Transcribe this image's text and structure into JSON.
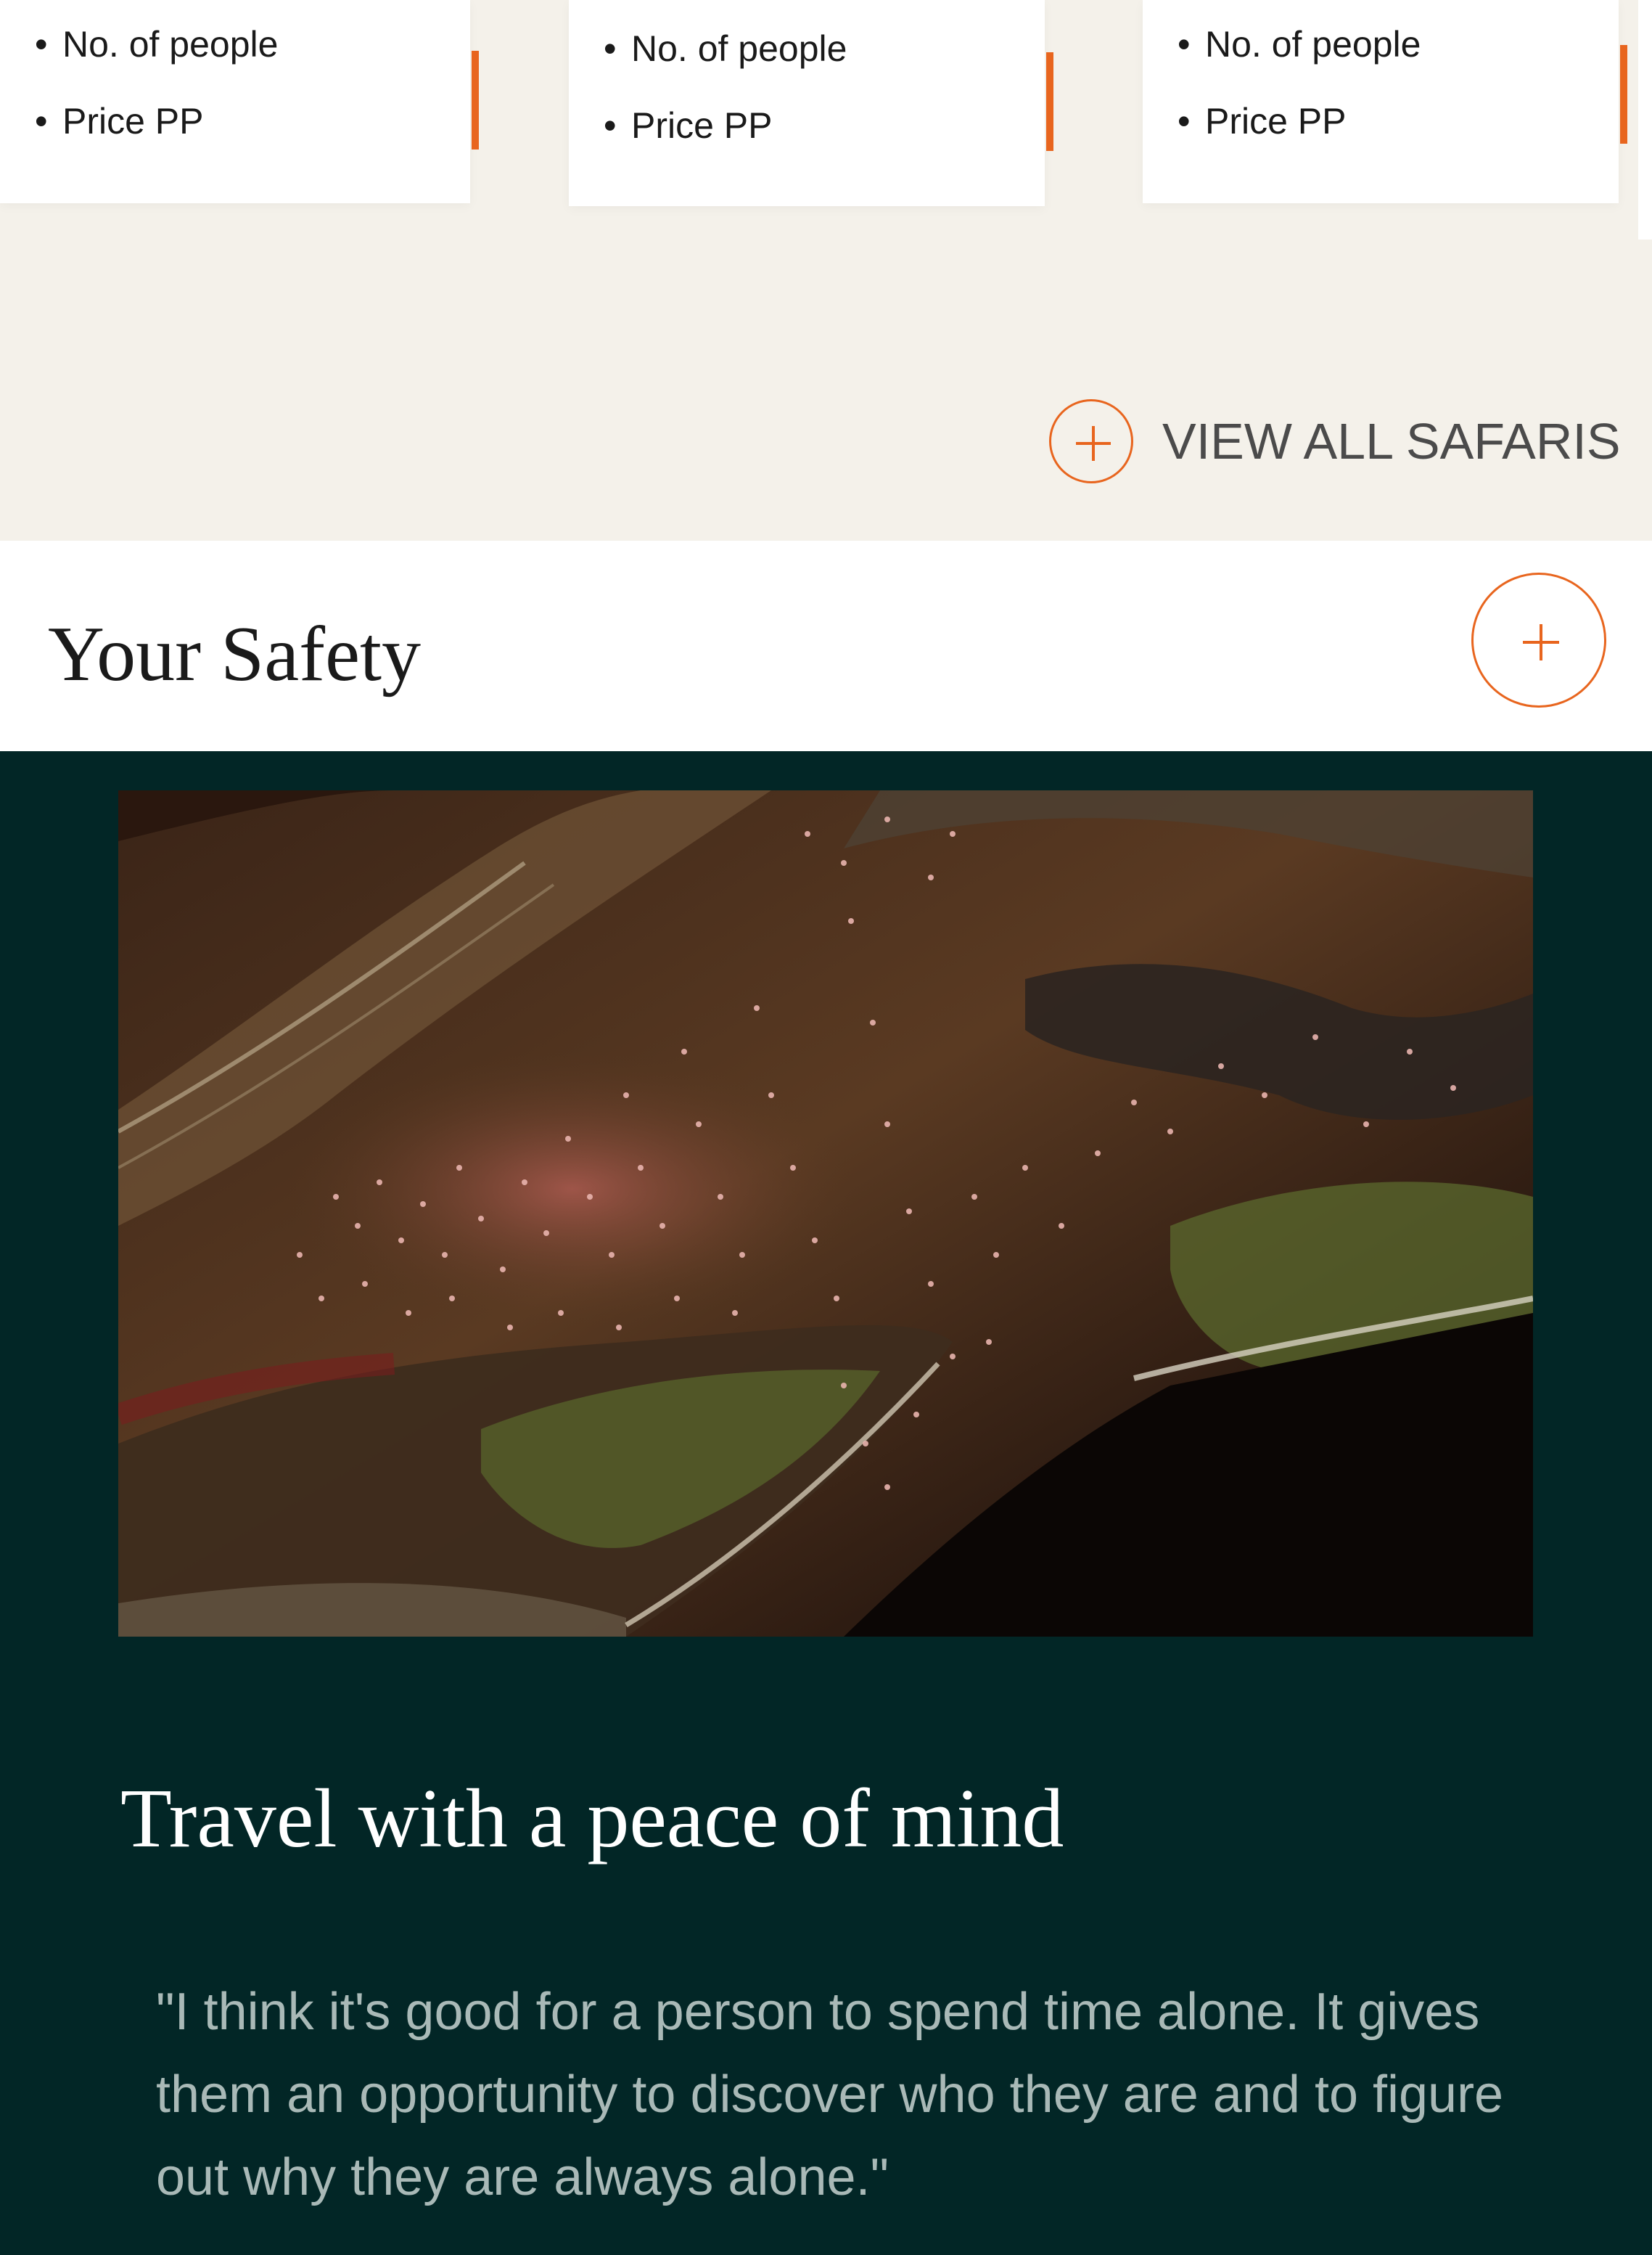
{
  "cards": [
    {
      "items": [
        "No. of people",
        "Price PP"
      ]
    },
    {
      "items": [
        "No. of people",
        "Price PP"
      ]
    },
    {
      "items": [
        "No. of people",
        "Price PP"
      ]
    }
  ],
  "view_all": {
    "label": "VIEW ALL SAFARIS",
    "icon": "plus-circle-icon"
  },
  "safety": {
    "title": "Your Safety",
    "toggle_icon": "plus-icon"
  },
  "feature": {
    "image_alt": "Aerial view of a flock of pink flamingos over a lake shore",
    "heading": "Travel with a peace of mind",
    "quote": "\"I think it's good for a person to spend time alone. It gives them an opportunity to discover who they are and to figure out why they are always alone.\""
  },
  "colors": {
    "accent": "#e8651e",
    "dark_bg": "#022626",
    "cream_bg": "#f4f1ea"
  }
}
